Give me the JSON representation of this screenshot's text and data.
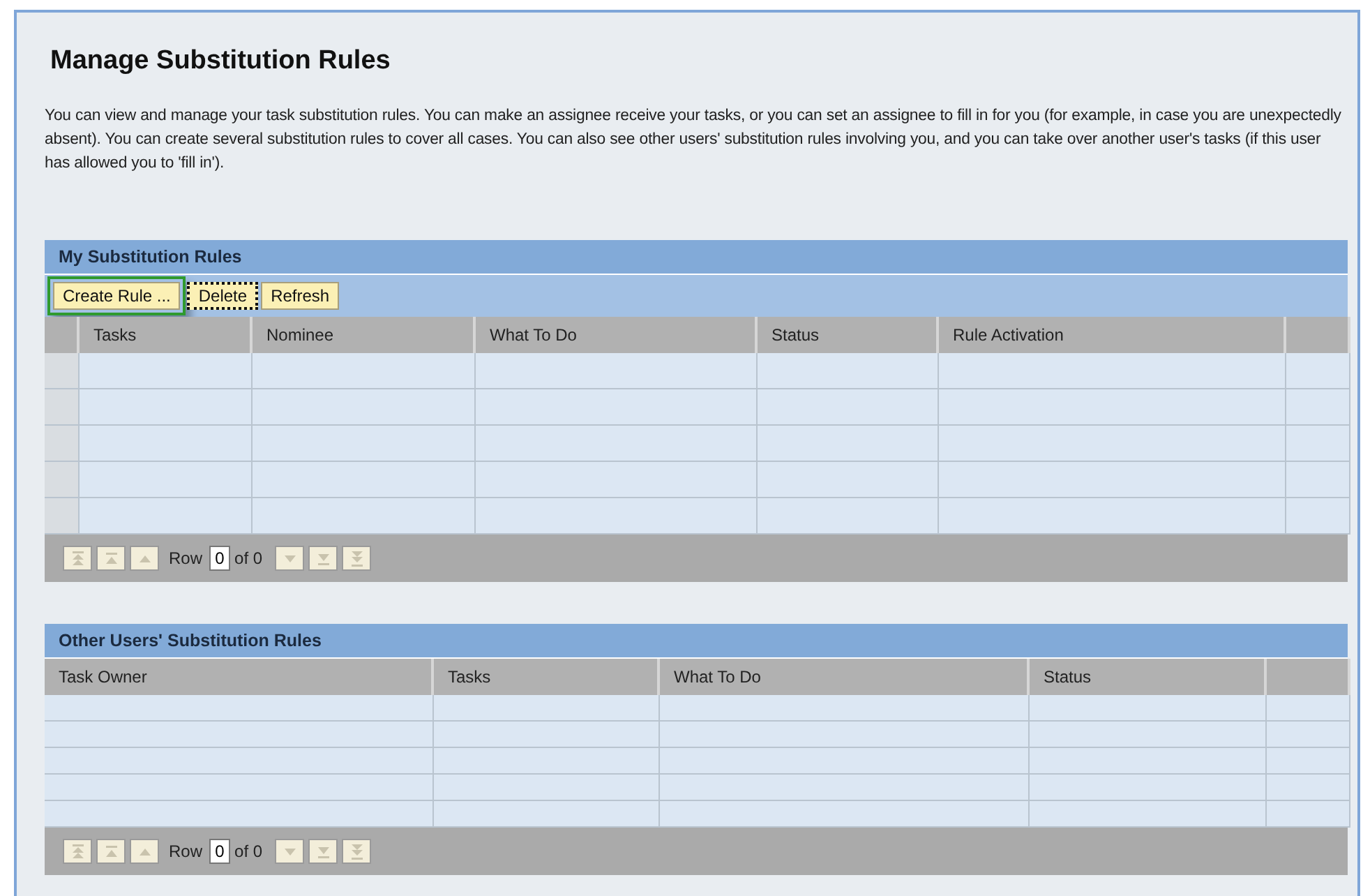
{
  "title": "Manage Substitution Rules",
  "description": "You can view and manage your task substitution rules. You can make an assignee receive your tasks, or you can set an assignee to fill in for you (for example, in case you are unexpectedly absent). You can create several substitution rules to cover all cases. You can also see other users' substitution rules involving you, and you can take over another user's tasks (if this user has allowed you to 'fill in').",
  "sections": [
    {
      "title": "My Substitution Rules",
      "row_selector": true,
      "buttons": [
        {
          "label": "Create Rule ...",
          "highlighted": true,
          "focused": false
        },
        {
          "label": "Delete",
          "highlighted": false,
          "focused": true
        },
        {
          "label": "Refresh",
          "highlighted": false,
          "focused": false
        }
      ],
      "columns": [
        "Tasks",
        "Nominee",
        "What To Do",
        "Status",
        "Rule Activation",
        ""
      ],
      "pager": {
        "label": "Row",
        "value": "0",
        "total": "of 0"
      }
    },
    {
      "title": "Other Users' Substitution Rules",
      "row_selector": false,
      "columns": [
        "Task Owner",
        "Tasks",
        "What To Do",
        "Status",
        ""
      ],
      "pager": {
        "label": "Row",
        "value": "0",
        "total": "of 0"
      }
    }
  ]
}
